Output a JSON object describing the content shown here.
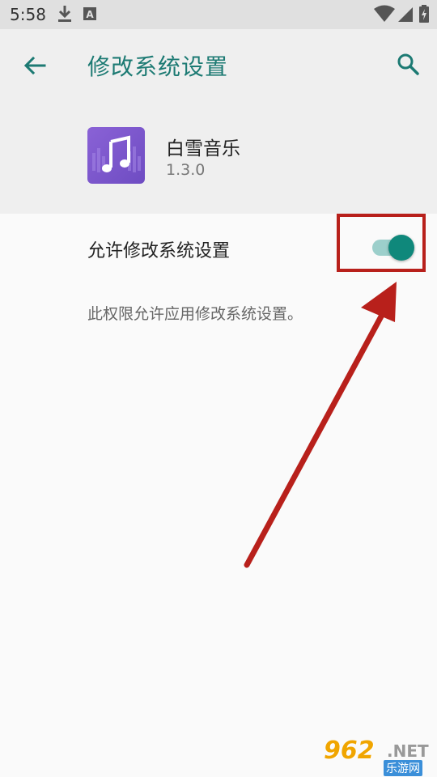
{
  "status_bar": {
    "time": "5:58",
    "icons": [
      "download-icon",
      "font-a-icon",
      "wifi-icon",
      "signal-icon",
      "battery-charging-icon"
    ]
  },
  "header": {
    "title": "修改系统设置",
    "back_icon": "arrow-left-icon",
    "search_icon": "search-icon",
    "accent_color": "#1c7a73"
  },
  "app": {
    "name": "白雪音乐",
    "version": "1.3.0",
    "icon": "music-note-icon",
    "icon_color": "#7b56cc"
  },
  "setting": {
    "label": "允许修改系统设置",
    "enabled": true,
    "description": "此权限允许应用修改系统设置。",
    "toggle_color": "#0f887b"
  },
  "annotation": {
    "color": "#b8201b"
  },
  "watermark": {
    "logo": "962",
    "suffix": ".NET",
    "sub": "乐游网"
  }
}
